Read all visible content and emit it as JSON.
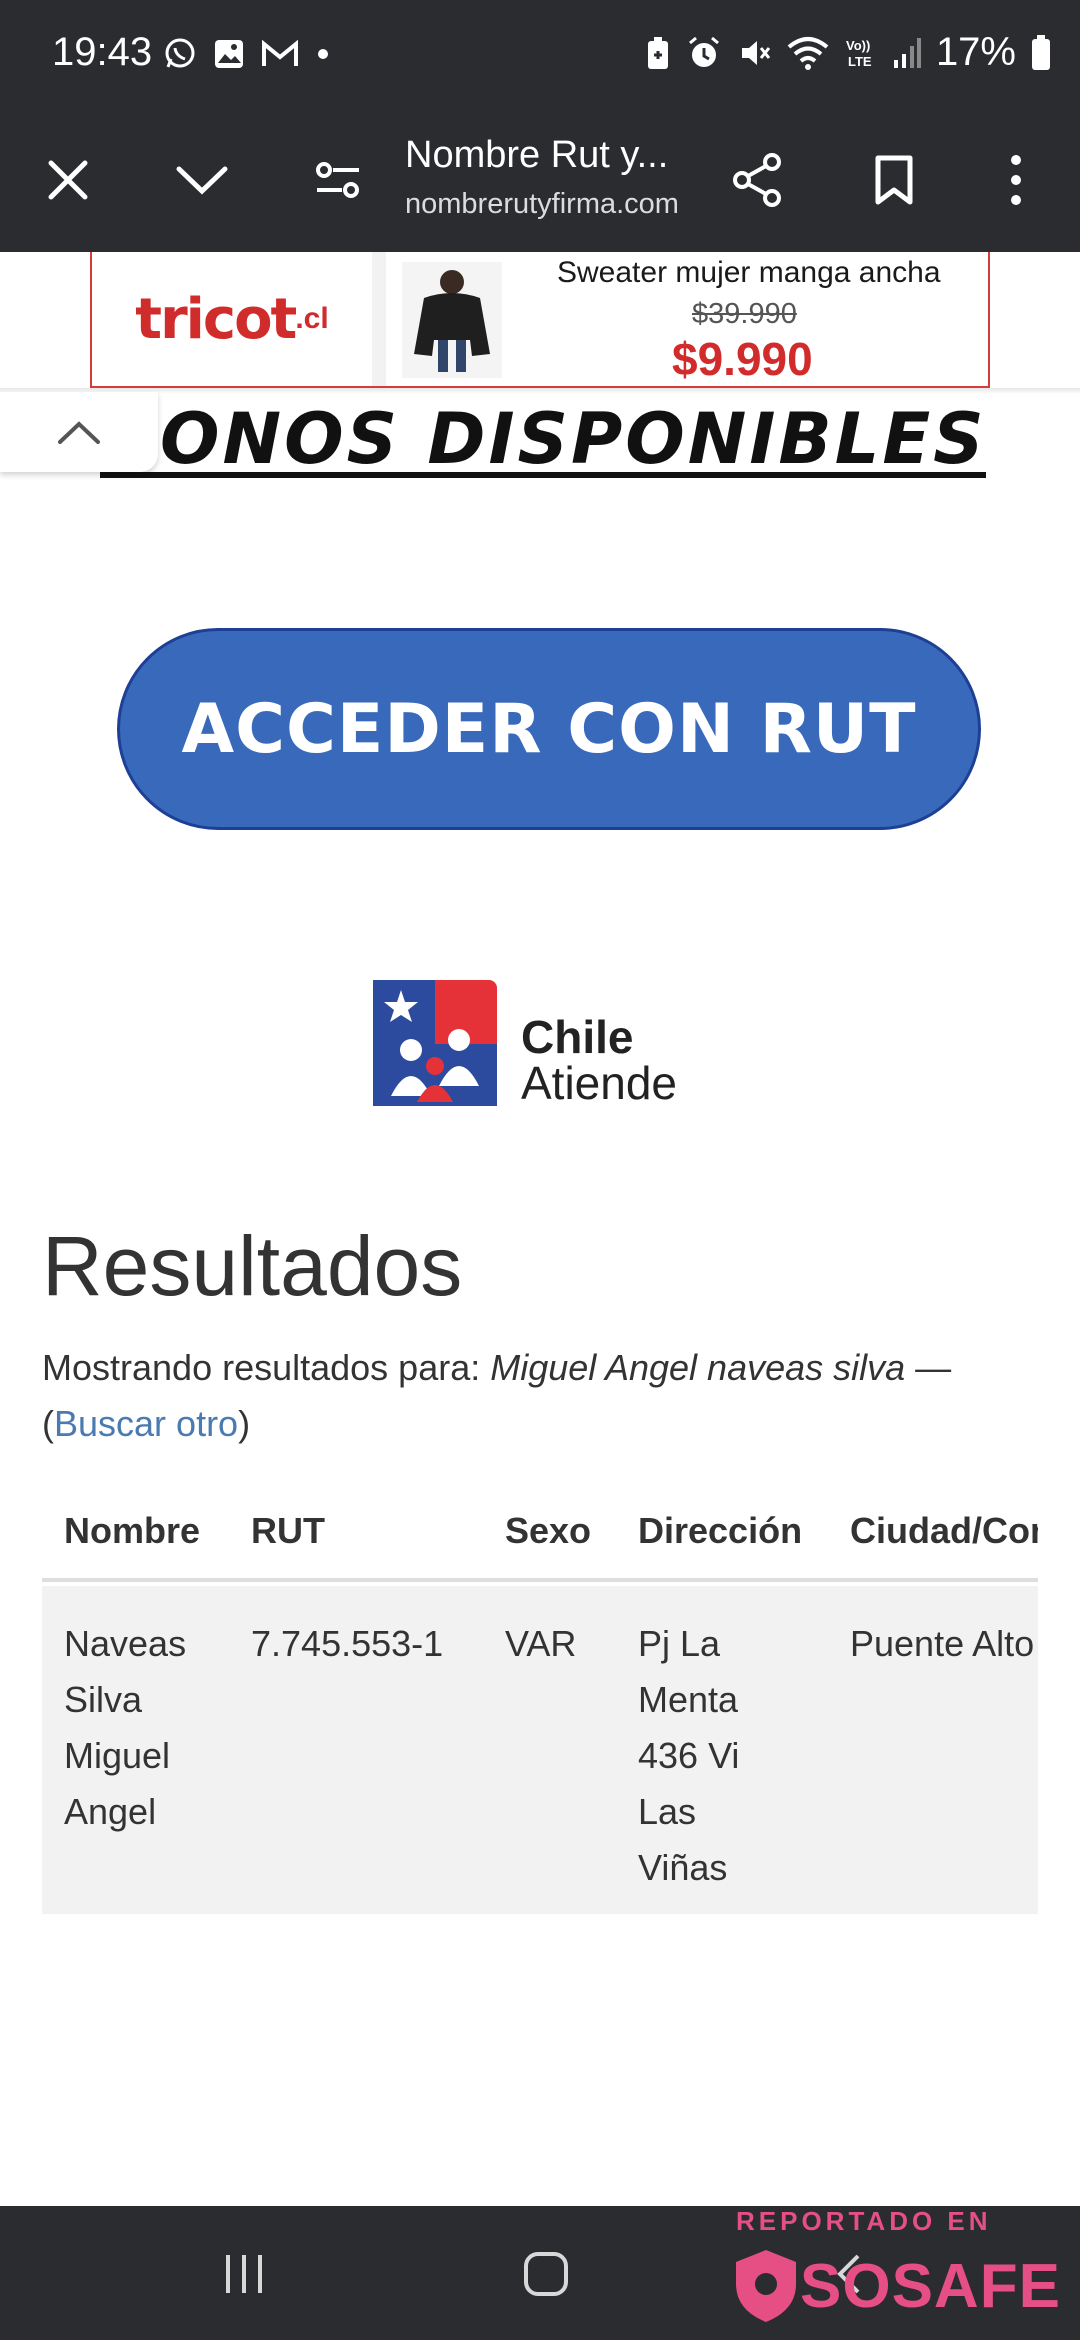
{
  "status_bar": {
    "time": "19:43",
    "battery": "17%",
    "left_icons": [
      "whatsapp-icon",
      "gallery-icon",
      "gmail-icon",
      "dot-icon"
    ],
    "right_icons": [
      "battery-saver-icon",
      "alarm-icon",
      "mute-icon",
      "wifi-icon",
      "volte-icon",
      "signal-icon",
      "battery-icon"
    ]
  },
  "toolbar": {
    "title": "Nombre Rut y...",
    "url": "nombrerutyfirma.com",
    "icons": [
      "close-icon",
      "chevron-down-icon",
      "page-settings-icon",
      "share-icon",
      "bookmark-icon",
      "more-vert-icon"
    ]
  },
  "ad": {
    "brand": "tricot",
    "brand_suffix": ".cl",
    "title": "Sweater mujer manga ancha",
    "old_price": "$39.990",
    "price": "$9.990"
  },
  "page": {
    "banner_heading": "ONOS DISPONIBLES",
    "cta_label": "ACCEDER CON RUT",
    "chile_line1": "Chile",
    "chile_line2": "Atiende",
    "results_title": "Resultados",
    "results_prefix": "Mostrando resultados para: ",
    "results_query": "Miguel Angel naveas silva",
    "results_dash": " —",
    "open_paren": "(",
    "search_again": "Buscar otro",
    "close_paren": ")"
  },
  "table": {
    "headers": [
      "Nombre",
      "RUT",
      "Sexo",
      "Dirección",
      "Ciudad/Comuna"
    ],
    "row": {
      "nombre_lines": [
        "Naveas",
        "Silva",
        "Miguel",
        "Angel"
      ],
      "rut": "7.745.553-1",
      "sexo": "VAR",
      "direccion_lines": [
        "Pj La",
        "Menta",
        "436 Vi",
        "Las",
        "Viñas"
      ],
      "ciudad": "Puente Alto"
    }
  },
  "nav_bar": {
    "icons": [
      "recents-icon",
      "home-icon",
      "back-icon"
    ]
  },
  "watermark": {
    "label": "REPORTADO EN",
    "brand": "SOSAFE"
  }
}
